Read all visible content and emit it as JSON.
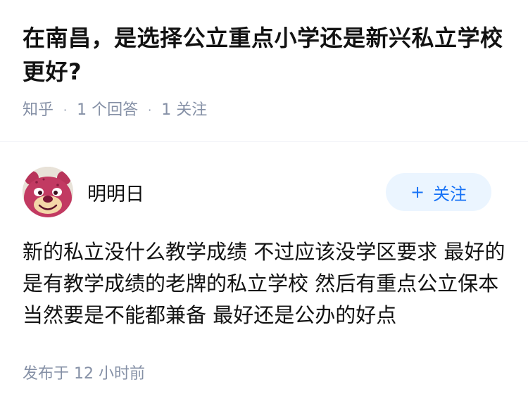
{
  "question": {
    "title": "在南昌，是选择公立重点小学还是新兴私立学校更好?",
    "source": "知乎",
    "answer_count": "1 个回答",
    "follow_count": "1 关注"
  },
  "answer": {
    "author_name": "明明日",
    "avatar_icon": "strawberry-bear-avatar",
    "follow_label": "关注",
    "follow_icon": "plus-icon",
    "body": "新的私立没什么教学成绩 不过应该没学区要求 最好的是有教学成绩的老牌的私立学校 然后有重点公立保本 当然要是不能都兼备 最好还是公办的好点",
    "published": "发布于  12 小时前"
  },
  "colors": {
    "meta_text": "#8590a6",
    "follow_bg": "#ebf5ff",
    "follow_text": "#1772f6",
    "divider": "#f0f2f7"
  }
}
